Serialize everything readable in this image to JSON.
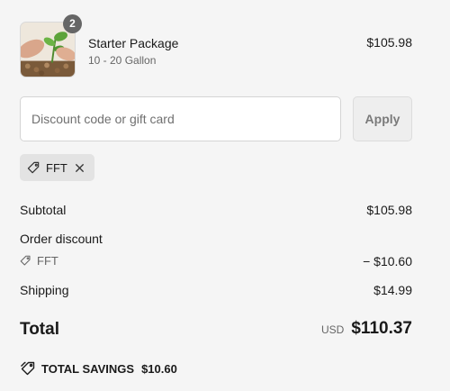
{
  "line_item": {
    "quantity": "2",
    "name": "Starter Package",
    "variant": "10 - 20 Gallon",
    "price": "$105.98"
  },
  "discount": {
    "placeholder": "Discount code or gift card",
    "apply_label": "Apply",
    "applied_code": "FFT"
  },
  "summary": {
    "subtotal_label": "Subtotal",
    "subtotal_value": "$105.98",
    "order_discount_label": "Order discount",
    "discount_code": "FFT",
    "discount_value": "− $10.60",
    "shipping_label": "Shipping",
    "shipping_value": "$14.99",
    "total_label": "Total",
    "currency": "USD",
    "total_value": "$110.37",
    "savings_label": "TOTAL SAVINGS",
    "savings_value": "$10.60"
  },
  "icons": {
    "tag": "tag-icon",
    "close": "close-icon",
    "savings": "savings-tag-icon"
  },
  "colors": {
    "background": "#f5f5f5",
    "badge": "#666666",
    "chip": "#e3e3e3"
  }
}
